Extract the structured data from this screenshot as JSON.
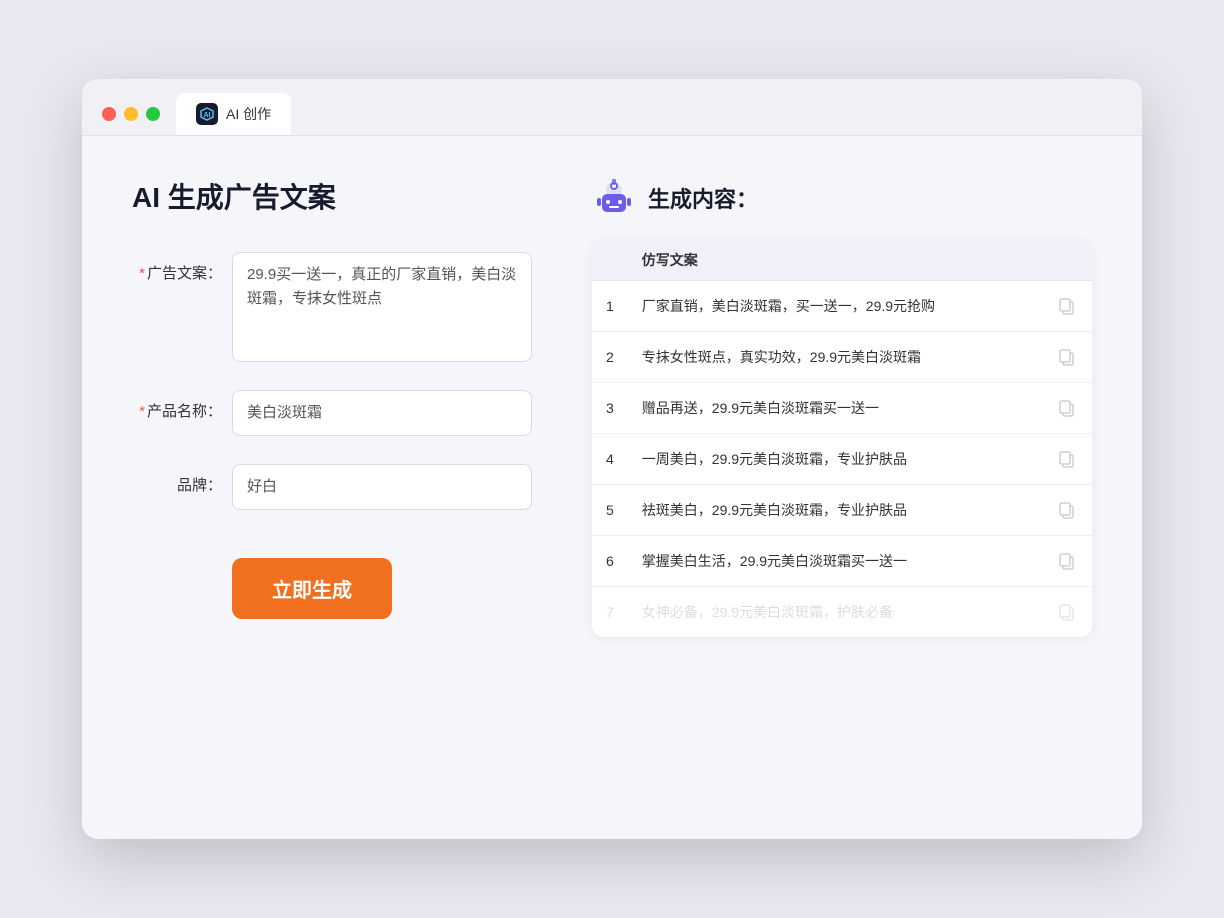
{
  "browser": {
    "tab_label": "AI 创作"
  },
  "page": {
    "title": "AI 生成广告文案",
    "form": {
      "ad_copy_label": "广告文案：",
      "ad_copy_required": "*",
      "ad_copy_value": "29.9买一送一，真正的厂家直销，美白淡斑霜，专抹女性斑点",
      "product_name_label": "产品名称：",
      "product_name_required": "*",
      "product_name_value": "美白淡斑霜",
      "brand_label": "品牌：",
      "brand_value": "好白",
      "generate_button": "立即生成"
    },
    "result": {
      "title": "生成内容：",
      "table_header": "仿写文案",
      "items": [
        {
          "num": "1",
          "text": "厂家直销，美白淡斑霜，买一送一，29.9元抢购"
        },
        {
          "num": "2",
          "text": "专抹女性斑点，真实功效，29.9元美白淡斑霜"
        },
        {
          "num": "3",
          "text": "赠品再送，29.9元美白淡斑霜买一送一"
        },
        {
          "num": "4",
          "text": "一周美白，29.9元美白淡斑霜，专业护肤品"
        },
        {
          "num": "5",
          "text": "祛斑美白，29.9元美白淡斑霜，专业护肤品"
        },
        {
          "num": "6",
          "text": "掌握美白生活，29.9元美白淡斑霜买一送一"
        },
        {
          "num": "7",
          "text": "女神必备，29.9元美白淡斑霜，护肤必备"
        }
      ]
    }
  }
}
